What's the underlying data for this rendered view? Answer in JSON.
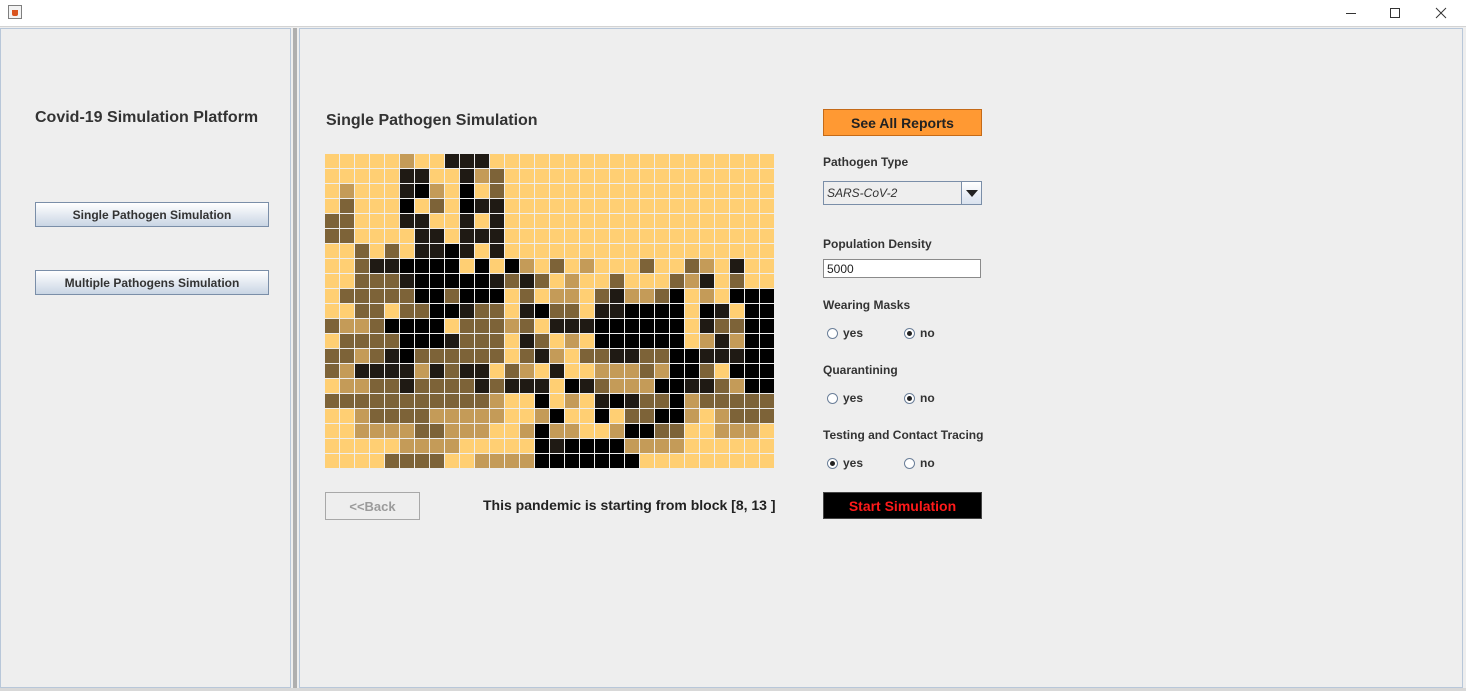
{
  "window": {
    "title": "",
    "controls": [
      "minimize-icon",
      "maximize-icon",
      "close-icon"
    ]
  },
  "sidebar": {
    "title": "Covid-19 Simulation Platform",
    "buttons": [
      {
        "label": "Single Pathogen Simulation"
      },
      {
        "label": "Multiple Pathogens Simulation"
      }
    ]
  },
  "main": {
    "title": "Single Pathogen Simulation",
    "back_label": "<<Back",
    "status": "This pandemic is starting from block [8, 13 ]"
  },
  "controls": {
    "reports_label": "See All Reports",
    "pathogen": {
      "label": "Pathogen Type",
      "value": "SARS-CoV-2"
    },
    "density": {
      "label": "Population Density",
      "value": "5000"
    },
    "masks": {
      "label": "Wearing Masks",
      "yes": "yes",
      "no": "no",
      "selected": "no"
    },
    "quarantine": {
      "label": "Quarantining",
      "yes": "yes",
      "no": "no",
      "selected": "no"
    },
    "testing": {
      "label": "Testing and Contact Tracing",
      "yes": "yes",
      "no": "no",
      "selected": "yes"
    },
    "start_label": "Start Simulation"
  },
  "grid": {
    "palette": [
      "#ffcf73",
      "#c49b58",
      "#7d6338",
      "#1f1a14",
      "#000000"
    ],
    "rows": [
      "000001003330000000000000000000",
      "000003300312000000000000000000",
      "010003410402000000000000000000",
      "020004020433000000000000000000",
      "220003300303000000000000000000",
      "220000330333000000000000000000",
      "002020334303000000000000000000",
      "002334444040410201000200210300",
      "002223444443232010020002130200",
      "022222442444020110231124010444",
      "002202244322034220334444043044",
      "211244440222120333444444032244",
      "022224443222032010444444013144",
      "221234222222023102233224433344",
      "213333132330210300111214420444",
      "011223222232333043211144332144",
      "222222222221004010343224122222",
      "001222211111001400402244101222",
      "001111221110014110014422001110",
      "000001111000004344441111000000",
      "000022220011114444444000000000"
    ]
  }
}
